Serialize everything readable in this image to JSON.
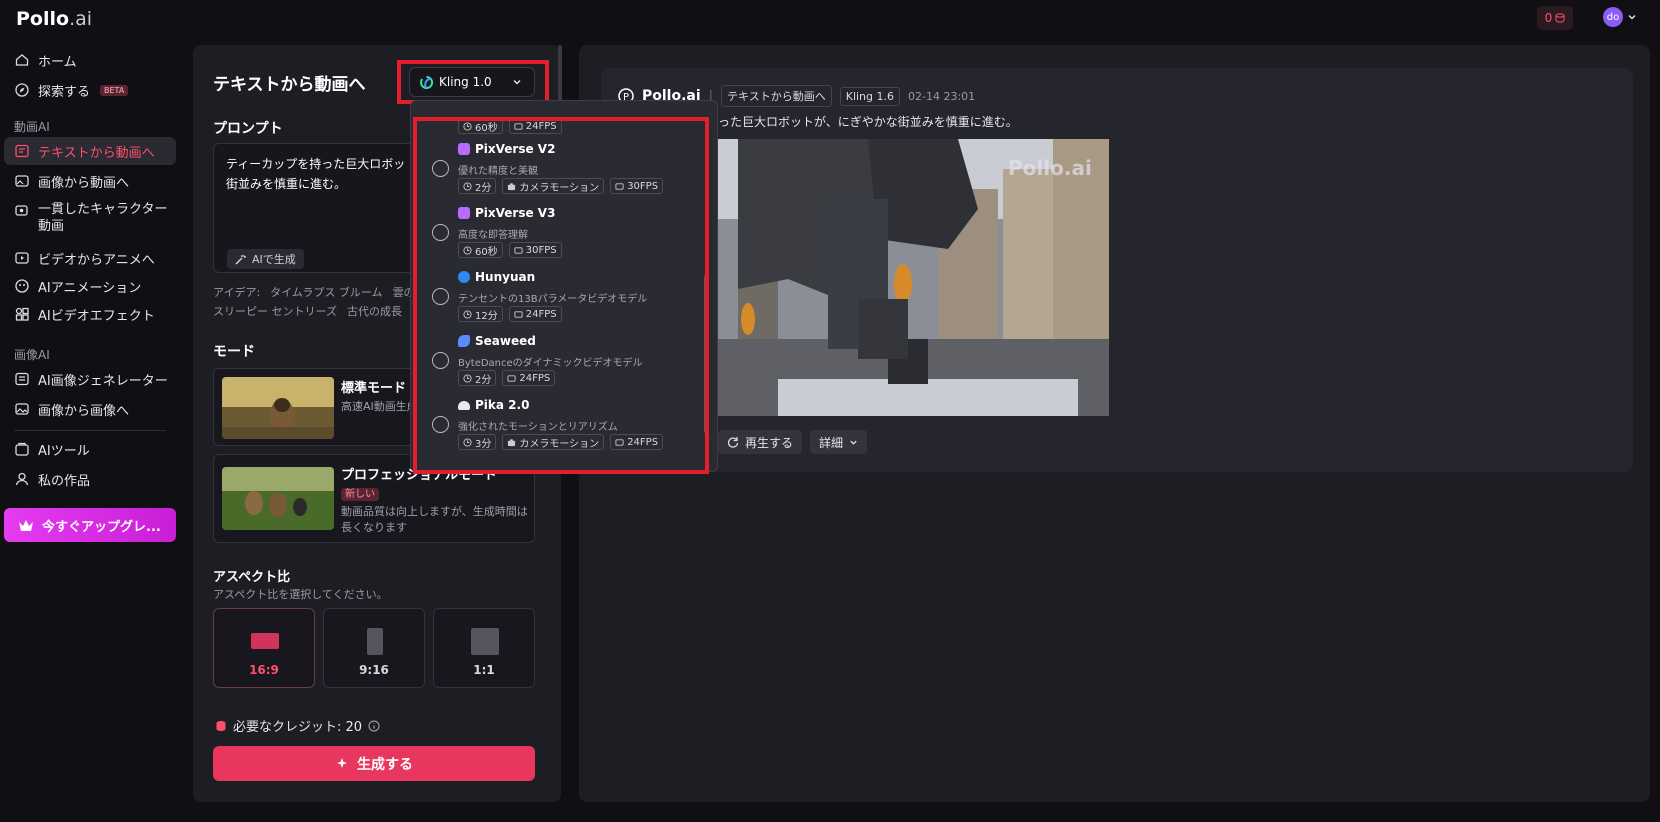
{
  "topbar": {
    "logo_main": "Pollo",
    "logo_suffix": ".ai",
    "credits": "0",
    "avatar_initials": "do"
  },
  "sidebar": {
    "items_top": [
      {
        "label": "ホーム",
        "icon": "home-icon"
      },
      {
        "label": "探索する",
        "icon": "compass-icon",
        "badge": "BETA"
      }
    ],
    "section_video": "動画AI",
    "video_items": [
      {
        "label": "テキストから動画へ",
        "icon": "text-video-icon",
        "active": true
      },
      {
        "label": "画像から動画へ",
        "icon": "image-video-icon"
      },
      {
        "label": "一貫したキャラクター動画",
        "icon": "character-icon"
      },
      {
        "label": "ビデオからアニメへ",
        "icon": "anime-icon"
      },
      {
        "label": "AIアニメーション",
        "icon": "animation-icon"
      },
      {
        "label": "AIビデオエフェクト",
        "icon": "effects-icon"
      }
    ],
    "section_image": "画像AI",
    "image_items": [
      {
        "label": "AI画像ジェネレーター",
        "icon": "image-gen-icon"
      },
      {
        "label": "画像から画像へ",
        "icon": "image-image-icon"
      }
    ],
    "bottom_items": [
      {
        "label": "AIツール",
        "icon": "tools-icon"
      },
      {
        "label": "私の作品",
        "icon": "user-icon"
      }
    ],
    "upgrade_label": "今すぐアップグレ..."
  },
  "panel": {
    "title": "テキストから動画へ",
    "model_selected": "Kling 1.0",
    "prompt_label": "プロンプト",
    "prompt_text": "ティーカップを持った巨大ロボッ",
    "prompt_text_2": "街並みを慎重に進む。",
    "ai_generate": "AIで生成",
    "ideas_label": "アイデア:",
    "ideas_row1": [
      "タイムラプス ブルーム",
      "雲の"
    ],
    "ideas_row2": [
      "スリーピー セントリーズ",
      "古代の成長"
    ],
    "mode_label": "モード",
    "modes": [
      {
        "title": "標準モード",
        "desc": "高速AI動画生成"
      },
      {
        "title": "プロフェッショナルモード",
        "badge": "新しい",
        "desc_1": "動画品質は向上しますが、生成時間は",
        "desc_2": "長くなります"
      }
    ],
    "aspect_label": "アスペクト比",
    "aspect_hint": "アスペクト比を選択してください。",
    "aspects": [
      "16:9",
      "9:16",
      "1:1"
    ],
    "credits_required": "必要なクレジット: 20",
    "generate_label": "生成する"
  },
  "result": {
    "brand": "Pollo.ai",
    "mode_chip": "テキストから動画へ",
    "model_chip": "Kling 1.6",
    "date": "02-14 23:01",
    "prompt_visible": "った巨大ロボットが、にぎやかな街並みを慎重に進む。",
    "watermark": "Pollo.ai",
    "replay_label": "再生する",
    "details_label": "詳細"
  },
  "dropdown": {
    "partial_tags": [
      "60秒",
      "24FPS"
    ],
    "options": [
      {
        "name": "PixVerse V2",
        "desc": "優れた精度と美観",
        "tags": [
          "2分",
          "カメラモーション",
          "30FPS"
        ],
        "color": "#b56bff"
      },
      {
        "name": "PixVerse V3",
        "desc": "高度な即答理解",
        "tags": [
          "60秒",
          "30FPS"
        ],
        "color": "#b56bff"
      },
      {
        "name": "Hunyuan",
        "desc": "テンセントの13Bパラメータビデオモデル",
        "tags": [
          "12分",
          "24FPS"
        ],
        "color": "#2d8cf0"
      },
      {
        "name": "Seaweed",
        "desc": "ByteDanceのダイナミックビデオモデル",
        "tags": [
          "2分",
          "24FPS"
        ],
        "color": "#5b8cff"
      },
      {
        "name": "Pika 2.0",
        "desc": "強化されたモーションとリアリズム",
        "tags": [
          "3分",
          "カメラモーション",
          "24FPS"
        ],
        "color": "#e8e8ee"
      }
    ]
  },
  "colors": {
    "accent": "#e8365f",
    "highlight_box": "#e41e2a",
    "upgrade_gradient": "#e63cf0"
  }
}
